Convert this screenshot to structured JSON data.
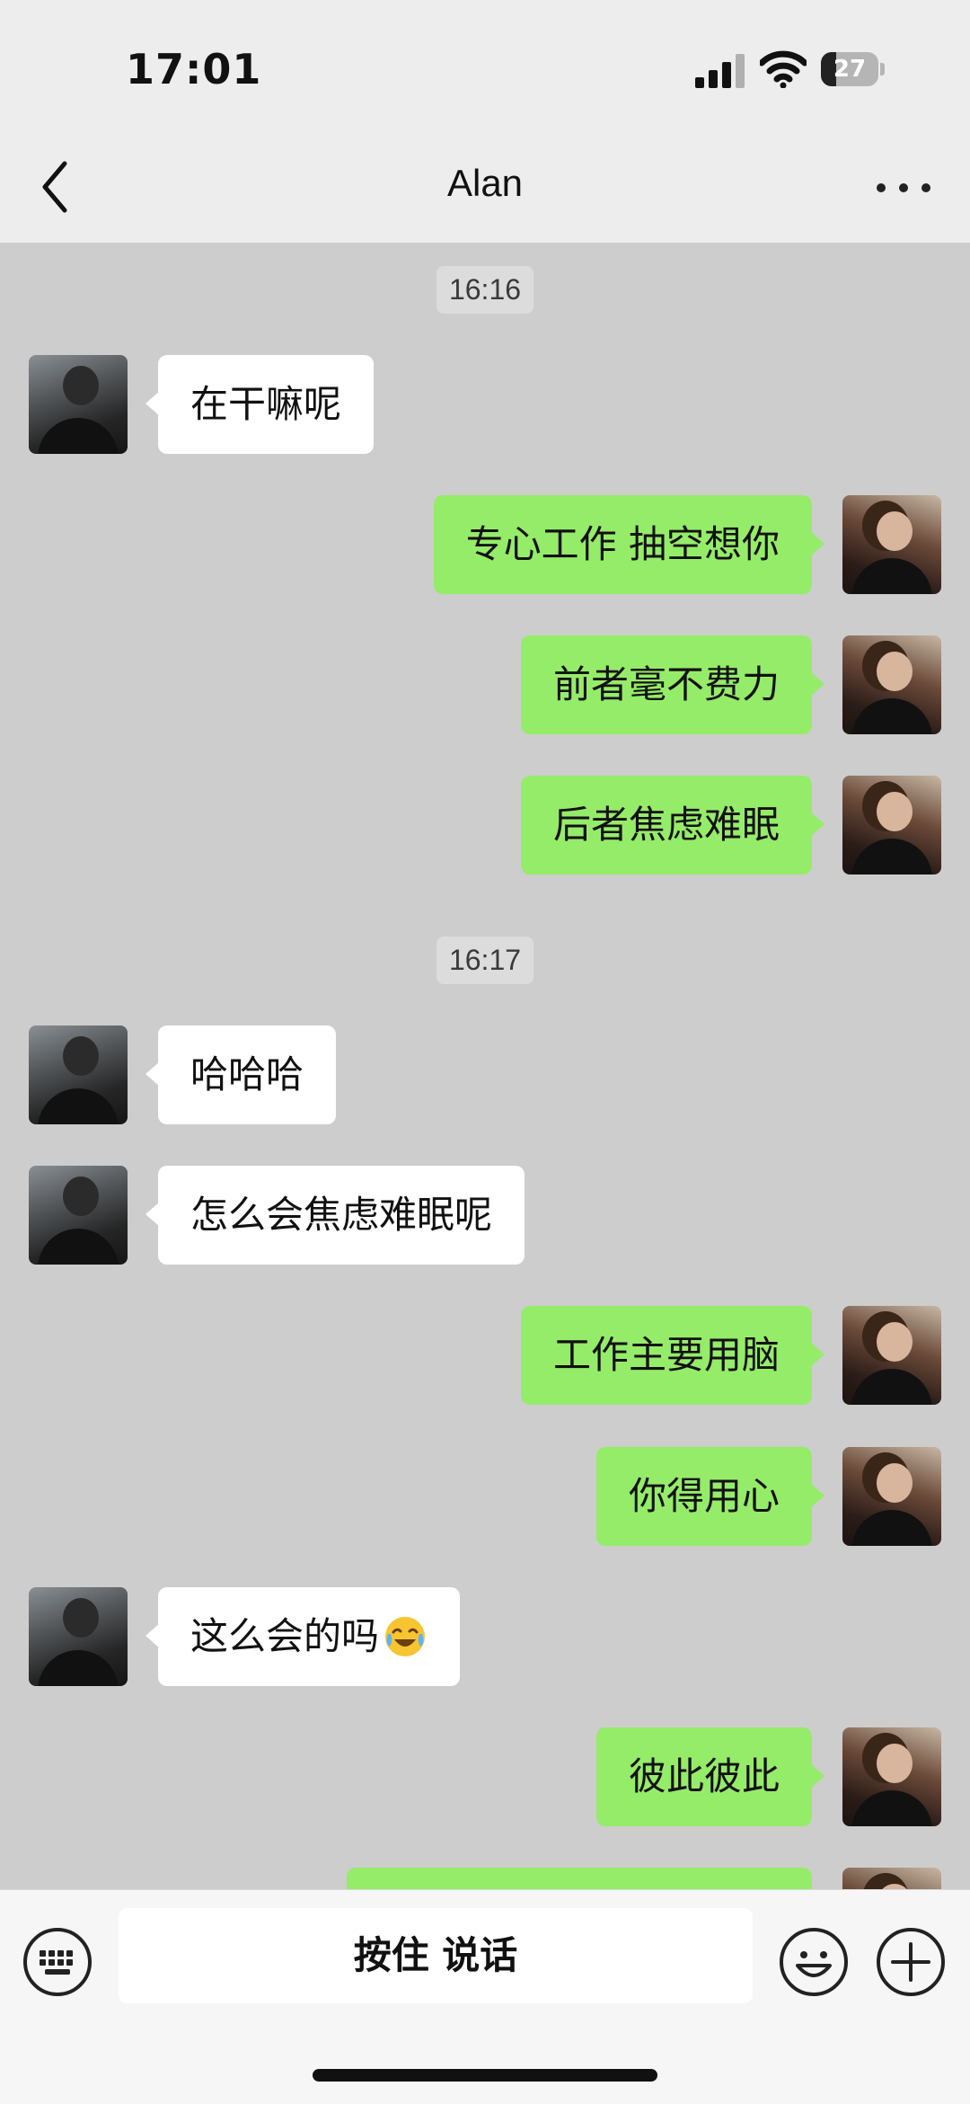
{
  "status_bar": {
    "time": "17:01",
    "battery": "27",
    "battery_level": 0.27
  },
  "nav": {
    "title": "Alan",
    "back_icon": "chevron-left-icon",
    "more_icon": "more-dots-icon"
  },
  "timestamps": [
    "16:16",
    "16:17"
  ],
  "messages": [
    {
      "side": "in",
      "text": "在干嘛呢"
    },
    {
      "side": "out",
      "text": "专心工作 抽空想你"
    },
    {
      "side": "out",
      "text": "前者毫不费力"
    },
    {
      "side": "out",
      "text": "后者焦虑难眠"
    },
    {
      "side": "in",
      "text": "哈哈哈"
    },
    {
      "side": "in",
      "text": "怎么会焦虑难眠呢"
    },
    {
      "side": "out",
      "text": "工作主要用脑"
    },
    {
      "side": "out",
      "text": "你得用心"
    },
    {
      "side": "in",
      "text": "这么会的吗",
      "emoji": "laughing-crying-face-icon"
    },
    {
      "side": "out",
      "text": "彼此彼此"
    },
    {
      "side": "out",
      "text": ""
    }
  ],
  "input_bar": {
    "voice_label": "按住 说话",
    "keyboard_icon": "keyboard-icon",
    "emoji_icon": "smiley-icon",
    "plus_icon": "plus-circle-icon"
  },
  "colors": {
    "chat_background": "#cdcdcd",
    "outgoing_bubble": "#95ec69",
    "incoming_bubble": "#ffffff",
    "bar_background": "#ededed"
  }
}
